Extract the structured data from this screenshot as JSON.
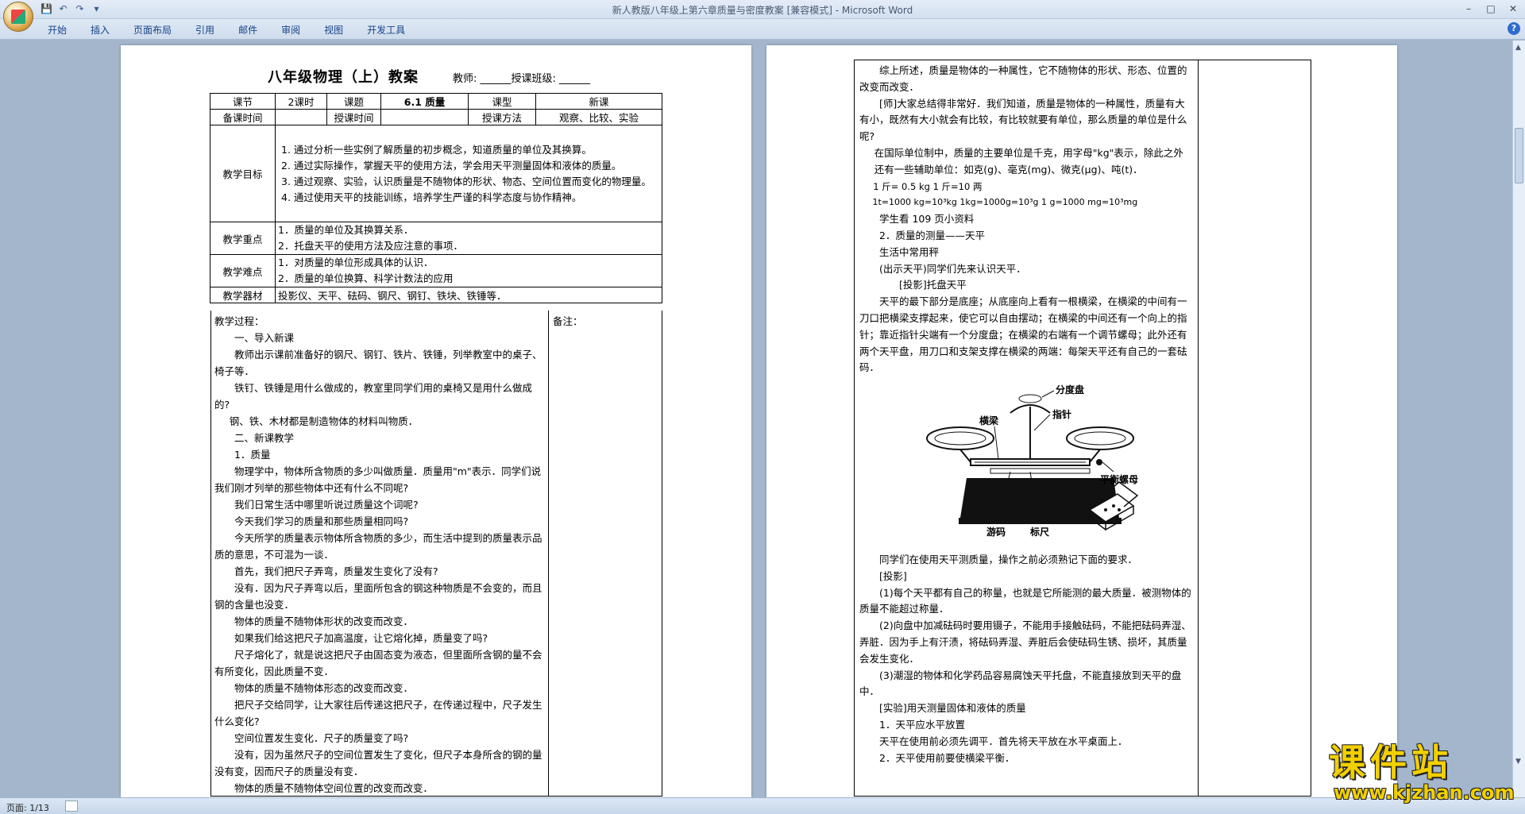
{
  "window": {
    "title": "新人教版八年级上第六章质量与密度教案 [兼容模式] - Microsoft Word",
    "quick_access": [
      "save-icon",
      "undo-icon",
      "redo-icon",
      "customize-icon"
    ],
    "controls": [
      "minimize",
      "maximize",
      "close"
    ]
  },
  "ribbon": {
    "tabs": [
      "开始",
      "插入",
      "页面布局",
      "引用",
      "邮件",
      "审阅",
      "视图",
      "开发工具"
    ],
    "help": "?"
  },
  "status": {
    "page": "页面: 1/13"
  },
  "page1": {
    "title": "八年级物理（上）教案",
    "sub": "教师: ______授课班级: ______",
    "row1": [
      "课节",
      "2课时",
      "课题",
      "6.1 质量",
      "课型",
      "新课"
    ],
    "row2": [
      "备课时间",
      "",
      "授课时间",
      "",
      "授课方法",
      "观察、比较、实验"
    ],
    "goal_label": "教学目标",
    "goals": [
      "1.  通过分析一些实例了解质量的初步概念，知道质量的单位及其换算。",
      "2.  通过实际操作，掌握天平的使用方法，学会用天平测量固体和液体的质量。",
      "3.  通过观察、实验，认识质量是不随物体的形状、物态、空间位置而变化的物理量。",
      "4.  通过使用天平的技能训练，培养学生严谨的科学态度与协作精神。"
    ],
    "key_label": "教学重点",
    "keys": [
      "1．质量的单位及其换算关系．",
      "2．托盘天平的使用方法及应注意的事项．"
    ],
    "hard_label": "教学难点",
    "hards": [
      "1．对质量的单位形成具体的认识．",
      "2．质量的单位换算、科学计数法的应用"
    ],
    "tool_label": "教学器材",
    "tools": "投影仪、天平、砝码、钢尺、钢钉、铁块、铁锤等．",
    "process_label": "教学过程：",
    "notes_label": "备注：",
    "process": [
      "一、导入新课",
      "教师出示课前准备好的钢尺、钢钉、铁片、铁锤，列举教室中的桌子、椅子等．",
      "铁钉、铁锤是用什么做成的，教室里同学们用的桌椅又是用什么做成的?",
      "钢、铁、木材都是制造物体的材料叫物质．",
      "二、新课教学",
      "1．质量",
      "物理学中，物体所含物质的多少叫做质量．质量用\"m\"表示．同学们说我们刚才列举的那些物体中还有什么不同呢?",
      "我们日常生活中哪里听说过质量这个词呢?",
      "今天我们学习的质量和那些质量相同吗?",
      "今天所学的质量表示物体所含物质的多少，而生活中提到的质量表示品质的意思，不可混为一谈．",
      "首先，我们把尺子弄弯，质量发生变化了没有?",
      "没有．因为尺子弄弯以后，里面所包含的钢这种物质是不会变的，而且钢的含量也没变．",
      "物体的质量不随物体形状的改变而改变．",
      "如果我们给这把尺子加高温度，让它熔化掉，质量变了吗?",
      "尺子熔化了，就是说这把尺子由固态变为液态，但里面所含钢的量不会有所变化，因此质量不变．",
      "物体的质量不随物体形态的改变而改变．",
      "把尺子交给同学，让大家往后传递这把尺子，在传递过程中，尺子发生什么变化?",
      "空间位置发生变化．尺子的质量变了吗?",
      "没有，因为虽然尺子的空间位置发生了变化，但尺子本身所含的钢的量没有变，因而尺子的质量没有变．",
      "物体的质量不随物体空间位置的改变而改变．"
    ]
  },
  "page2": {
    "lines_top": [
      "综上所述，质量是物体的一种属性，它不随物体的形状、形态、位置的改变而改变．",
      "[师]大家总结得非常好．我们知道，质量是物体的一种属性，质量有大有小，既然有大小就会有比较，有比较就要有单位，那么质量的单位是什么呢?",
      "在国际单位制中，质量的主要单位是千克，用字母\"kg\"表示，除此之外还有一些辅助单位：如克(g)、毫克(mg)、微克(μg)、吨(t)．",
      "1 斤= 0.5 kg   1 斤=10 两",
      "1t=1000 kg=10³kg    1kg=1000g=10³g    1 g=1000 mg=10³mg",
      "学生看 109 页小资料",
      "2．质量的测量——天平",
      "生活中常用秤",
      "(出示天平)同学们先来认识天平．",
      "[投影]托盘天平",
      "天平的最下部分是底座；从底座向上看有一根横梁，在横梁的中间有一刀口把横梁支撑起来，使它可以自由摆动；在横梁的中间还有一个向上的指针；靠近指针尖端有一个分度盘；在横梁的右端有一个调节螺母；此外还有两个天平盘，用刀口和支架支撑在横梁的两端：每架天平还有自己的一套砝码．"
    ],
    "figure_labels": {
      "scale": "分度盘",
      "beam": "横梁",
      "pointer": "指针",
      "nut": "平衡螺母",
      "rider": "游码",
      "ruler": "标尺"
    },
    "lines_bottom": [
      "同学们在使用天平测质量，操作之前必须熟记下面的要求．",
      "[投影]",
      "(1)每个天平都有自己的称量，也就是它所能测的最大质量．被测物体的质量不能超过称量．",
      "(2)向盘中加减砝码时要用镊子，不能用手接触砝码，不能把砝码弄湿、弄脏．因为手上有汗渍，将砝码弄湿、弄脏后会使砝码生锈、损坏，其质量会发生变化．",
      "(3)潮湿的物体和化学药品容易腐蚀天平托盘，不能直接放到天平的盘中．",
      "[实验]用天测量固体和液体的质量",
      "1．天平应水平放置",
      "天平在使用前必须先调平．首先将天平放在水平桌面上．",
      "2．天平使用前要使横梁平衡．"
    ]
  },
  "watermark": {
    "big": "课件站",
    "url": "www.kjzhan.com"
  }
}
